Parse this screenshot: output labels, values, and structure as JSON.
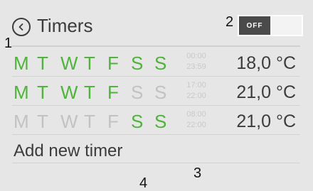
{
  "header": {
    "title": "Timers",
    "back_icon": "chevron-left-circle-icon",
    "toggle_state": "OFF"
  },
  "timers": [
    {
      "days": [
        {
          "label": "M",
          "active": true
        },
        {
          "label": "T",
          "active": true
        },
        {
          "label": "W",
          "active": true
        },
        {
          "label": "T",
          "active": true
        },
        {
          "label": "F",
          "active": true
        },
        {
          "label": "S",
          "active": true
        },
        {
          "label": "S",
          "active": true
        }
      ],
      "start": "00:00",
      "end": "23:59",
      "temperature": "18,0 °C"
    },
    {
      "days": [
        {
          "label": "M",
          "active": true
        },
        {
          "label": "T",
          "active": true
        },
        {
          "label": "W",
          "active": true
        },
        {
          "label": "T",
          "active": true
        },
        {
          "label": "F",
          "active": true
        },
        {
          "label": "S",
          "active": false
        },
        {
          "label": "S",
          "active": false
        }
      ],
      "start": "17:00",
      "end": "22:00",
      "temperature": "21,0 °C"
    },
    {
      "days": [
        {
          "label": "M",
          "active": false
        },
        {
          "label": "T",
          "active": false
        },
        {
          "label": "W",
          "active": false
        },
        {
          "label": "T",
          "active": false
        },
        {
          "label": "F",
          "active": false
        },
        {
          "label": "S",
          "active": true
        },
        {
          "label": "S",
          "active": true
        }
      ],
      "start": "08:00",
      "end": "22:00",
      "temperature": "21,0 °C"
    }
  ],
  "add_timer_label": "Add new timer",
  "markers": [
    "1",
    "2",
    "3",
    "4"
  ],
  "colors": {
    "background": "#e6e6e6",
    "day_active": "#4eb43a",
    "day_inactive": "#c2c2c2",
    "text": "#3c3c3c",
    "toggle_off": "#4a4a4a"
  }
}
